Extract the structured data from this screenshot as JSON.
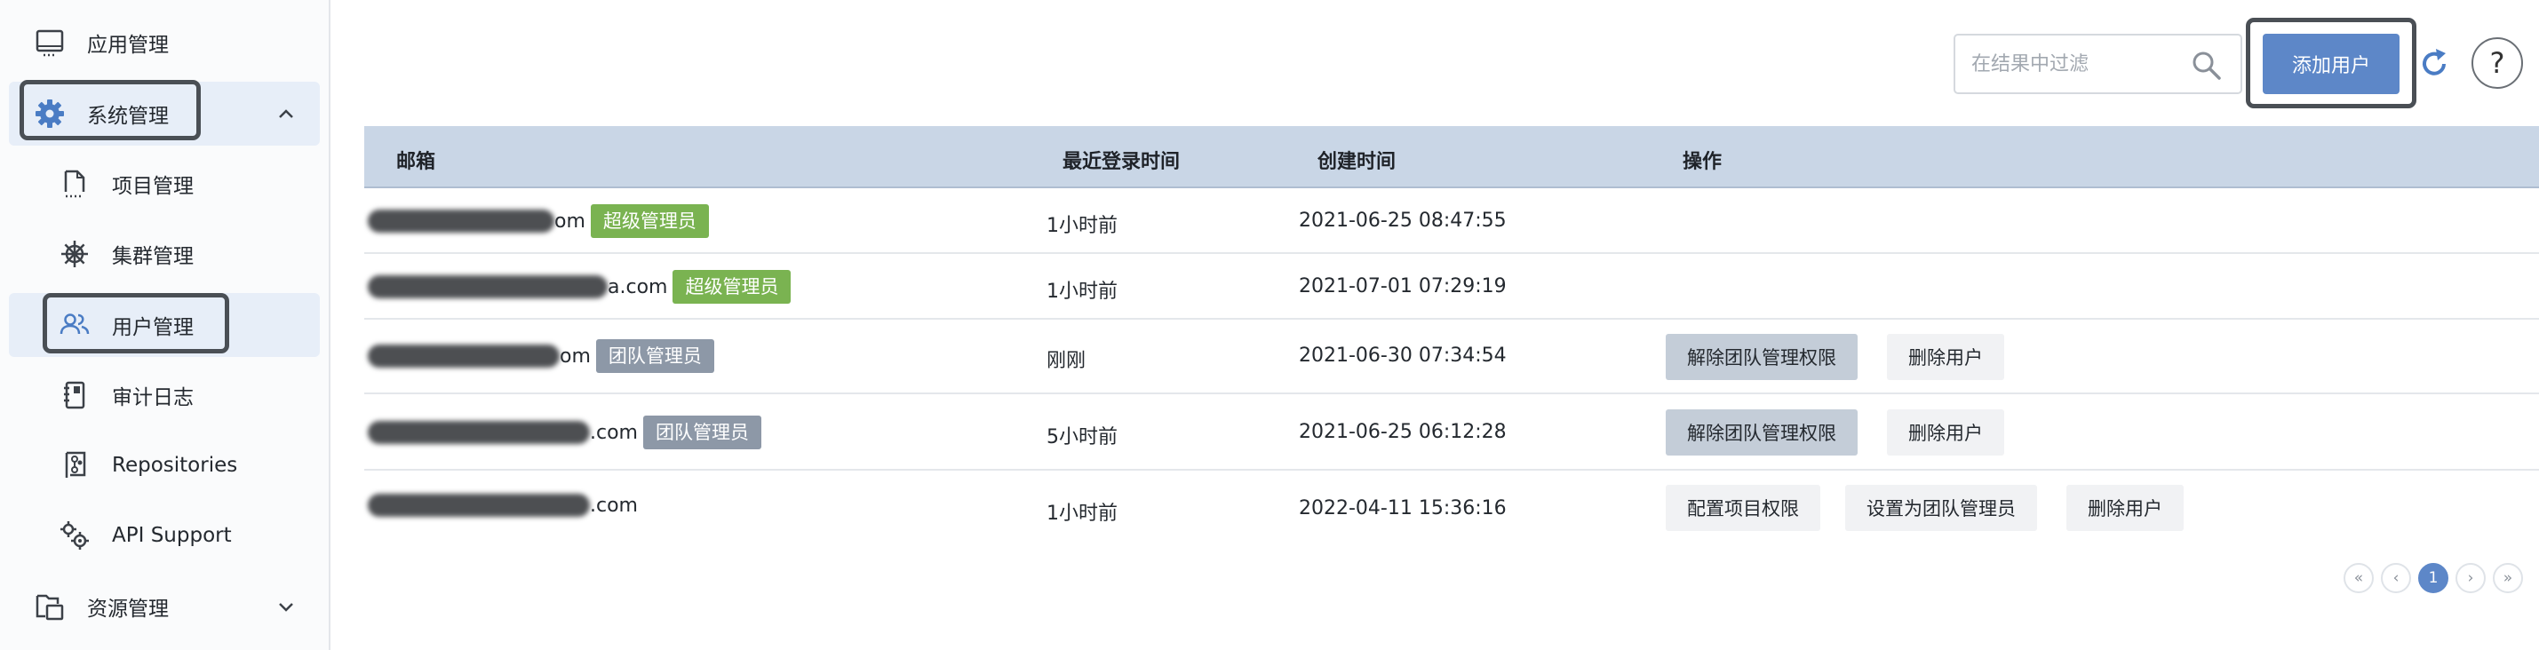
{
  "sidebar": {
    "items": [
      {
        "label": "应用管理",
        "icon": "monitor-icon"
      },
      {
        "label": "系统管理",
        "icon": "gear-icon"
      },
      {
        "label": "项目管理",
        "icon": "file-icon"
      },
      {
        "label": "集群管理",
        "icon": "helm-wheel-icon"
      },
      {
        "label": "用户管理",
        "icon": "users-icon"
      },
      {
        "label": "审计日志",
        "icon": "notebook-icon"
      },
      {
        "label": "Repositories",
        "icon": "repository-icon"
      },
      {
        "label": "API Support",
        "icon": "gears-icon"
      },
      {
        "label": "资源管理",
        "icon": "folders-icon"
      }
    ]
  },
  "toolbar": {
    "search_placeholder": "在结果中过滤",
    "add_label": "添加用户",
    "help_label": "?"
  },
  "table": {
    "headers": {
      "email": "邮箱",
      "last_login": "最近登录时间",
      "created": "创建时间",
      "actions": "操作"
    },
    "rows": [
      {
        "email_tail": "om",
        "badge": "超级管理员",
        "last_login": "1小时前",
        "created": "2021-06-25 08:47:55",
        "actions": []
      },
      {
        "email_tail": "a.com",
        "badge": "超级管理员",
        "last_login": "1小时前",
        "created": "2021-07-01 07:29:19",
        "actions": []
      },
      {
        "email_tail": "om",
        "badge": "团队管理员",
        "last_login": "刚刚",
        "created": "2021-06-30 07:34:54",
        "actions": [
          "解除团队管理权限",
          "删除用户"
        ]
      },
      {
        "email_tail": ".com",
        "badge": "团队管理员",
        "last_login": "5小时前",
        "created": "2021-06-25 06:12:28",
        "actions": [
          "解除团队管理权限",
          "删除用户"
        ]
      },
      {
        "email_tail": ".com",
        "badge": "",
        "last_login": "1小时前",
        "created": "2022-04-11 15:36:16",
        "actions": [
          "配置项目权限",
          "设置为团队管理员",
          "删除用户"
        ]
      }
    ]
  },
  "pagination": {
    "first": "«",
    "prev": "‹",
    "current": "1",
    "next": "›",
    "last": "»"
  },
  "colors": {
    "primary": "#5d87c8",
    "super_badge": "#7ab351",
    "team_badge": "#8d98a7",
    "header_bg": "#c9d6e6"
  }
}
